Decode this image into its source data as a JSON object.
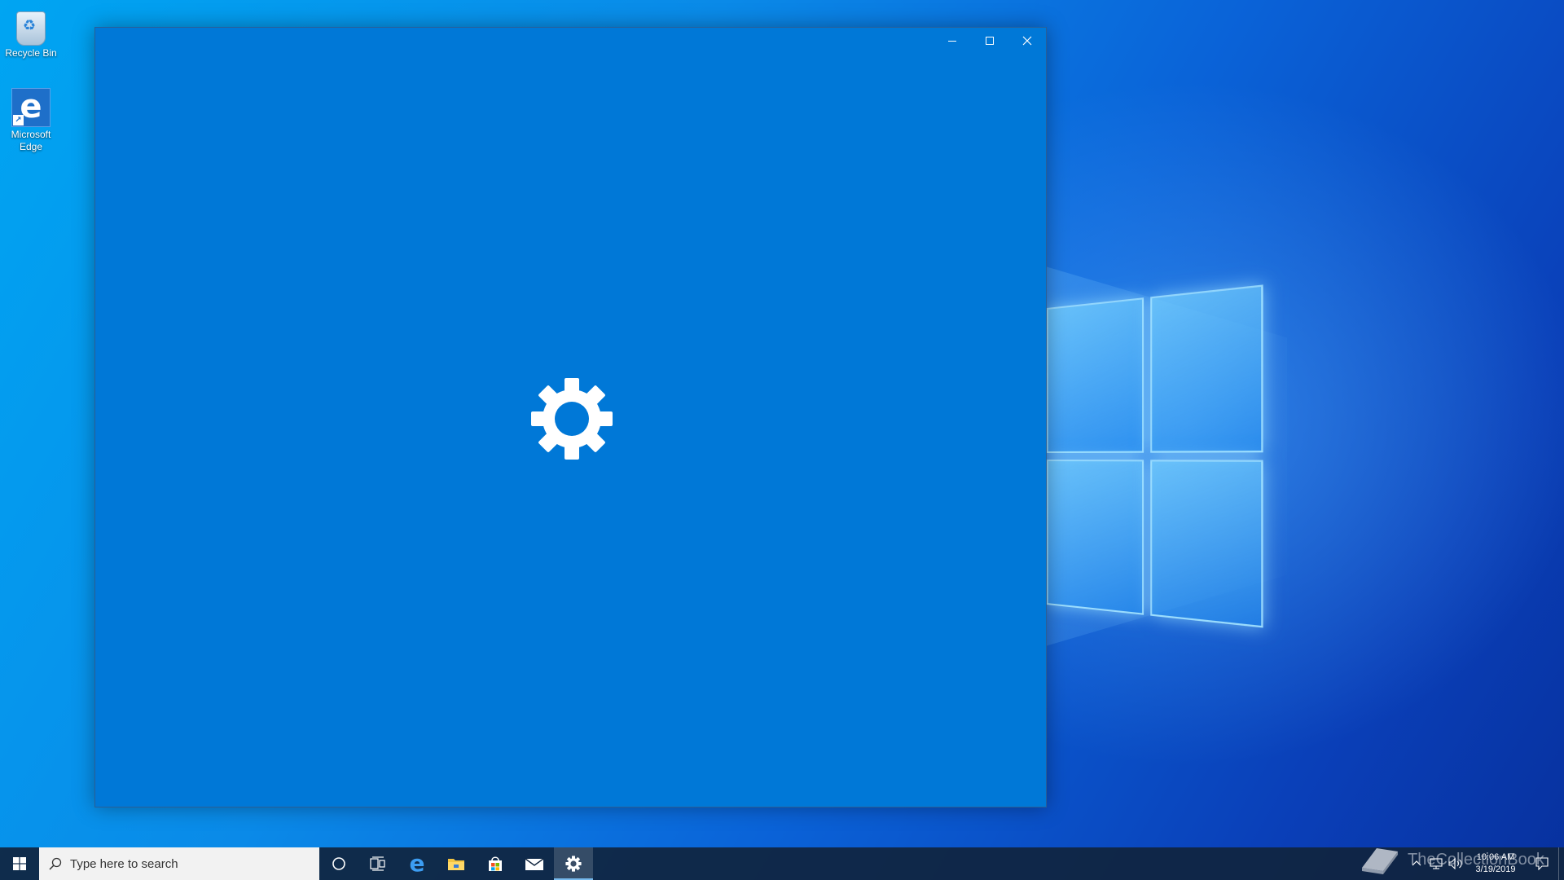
{
  "desktop": {
    "icons": [
      {
        "label": "Recycle Bin",
        "icon": "recycle-bin-icon"
      },
      {
        "label": "Microsoft Edge",
        "icon": "edge-icon"
      }
    ]
  },
  "window": {
    "app": "Settings",
    "state": "loading",
    "background_color": "#0078d7",
    "splash_icon": "gear-icon",
    "controls": {
      "minimize": "minimize-icon",
      "maximize": "maximize-icon",
      "close": "close-icon"
    }
  },
  "taskbar": {
    "search": {
      "placeholder": "Type here to search"
    },
    "pinned": [
      {
        "name": "Cortana",
        "icon": "cortana-icon"
      },
      {
        "name": "Task View",
        "icon": "task-view-icon"
      },
      {
        "name": "Microsoft Edge",
        "icon": "edge-icon"
      },
      {
        "name": "File Explorer",
        "icon": "folder-icon"
      },
      {
        "name": "Microsoft Store",
        "icon": "store-icon"
      },
      {
        "name": "Mail",
        "icon": "mail-icon"
      },
      {
        "name": "Settings",
        "icon": "gear-icon",
        "active": true
      }
    ],
    "clock": {
      "time": "10:06 AM",
      "date": "3/19/2019"
    }
  },
  "watermark": {
    "text": "TheCollectionBook"
  },
  "colors": {
    "accent": "#0078d7",
    "taskbar": "#10243e",
    "active_indicator": "#76b9ed"
  }
}
